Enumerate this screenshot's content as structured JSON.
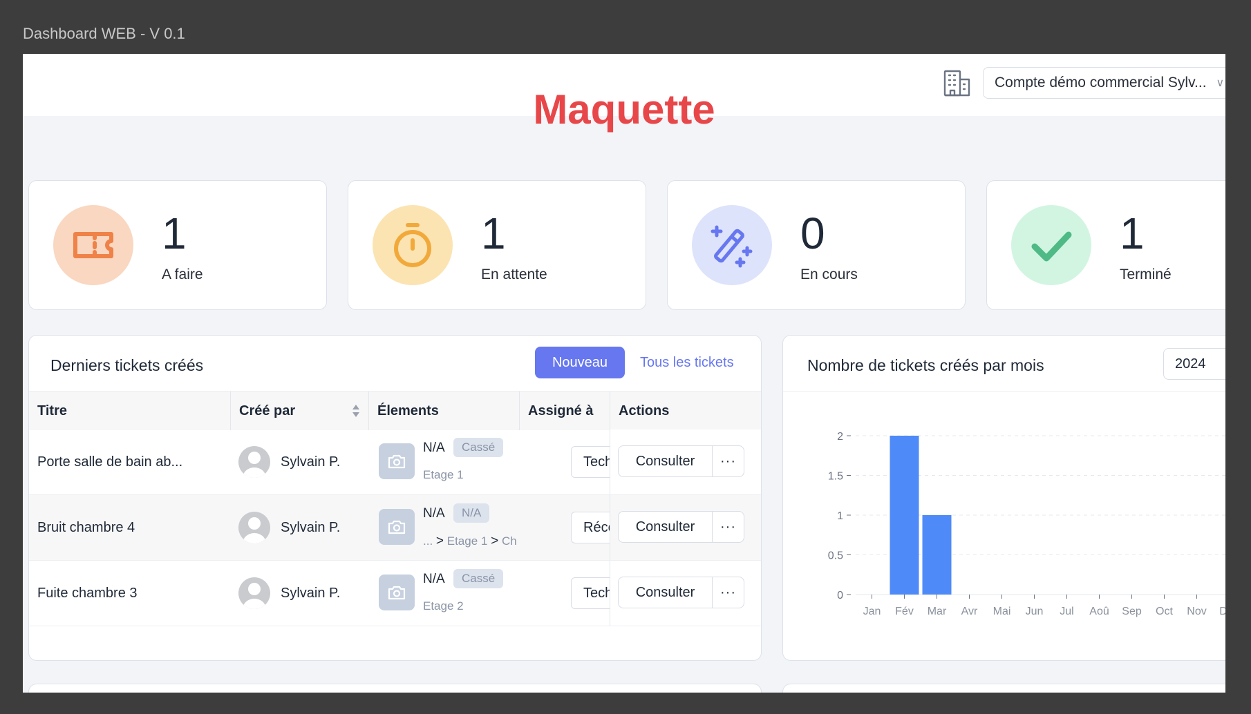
{
  "frame": {
    "title": "Dashboard WEB - V 0.1"
  },
  "header": {
    "account": "Compte démo commercial Sylv...",
    "watermark": "Maquette"
  },
  "stats": [
    {
      "count": "1",
      "label": "A faire",
      "icon": "ticket-icon",
      "bg": "#f9d7c0",
      "color": "#ef8248"
    },
    {
      "count": "1",
      "label": "En attente",
      "icon": "stopwatch-icon",
      "bg": "#fbe4b2",
      "color": "#f2a93b"
    },
    {
      "count": "0",
      "label": "En cours",
      "icon": "magic-wand-icon",
      "bg": "#dde3fb",
      "color": "#6677f0"
    },
    {
      "count": "1",
      "label": "Terminé",
      "icon": "checkmark-icon",
      "bg": "#d2f5e2",
      "color": "#4fba85"
    }
  ],
  "tickets": {
    "title": "Derniers tickets créés",
    "new_label": "Nouveau",
    "all_label": "Tous les tickets",
    "columns": [
      "Titre",
      "Créé par",
      "Élements",
      "Assigné à",
      "Actions"
    ],
    "rows": [
      {
        "title": "Porte salle de bain ab...",
        "creator": "Sylvain P.",
        "element": "N/A",
        "badge": "Cassé",
        "loc_parts": [
          "Etage 1"
        ],
        "assigned": "Tech",
        "consult": "Consulter",
        "more": "···"
      },
      {
        "title": "Bruit chambre 4",
        "creator": "Sylvain P.",
        "element": "N/A",
        "badge": "N/A",
        "loc_parts": [
          "...",
          ">",
          "Etage 1",
          ">",
          "Ch"
        ],
        "assigned": "Réce",
        "consult": "Consulter",
        "more": "···"
      },
      {
        "title": "Fuite chambre 3",
        "creator": "Sylvain P.",
        "element": "N/A",
        "badge": "Cassé",
        "loc_parts": [
          "Etage 2"
        ],
        "assigned": "Tech",
        "consult": "Consulter",
        "more": "···"
      }
    ]
  },
  "chart_panel": {
    "title": "Nombre de tickets créés par mois",
    "year": "2024"
  },
  "chart_data": {
    "type": "bar",
    "categories": [
      "Jan",
      "Fév",
      "Mar",
      "Avr",
      "Mai",
      "Jun",
      "Jul",
      "Aoû",
      "Sep",
      "Oct",
      "Nov",
      "Déc"
    ],
    "values": [
      0,
      2,
      1,
      0,
      0,
      0,
      0,
      0,
      0,
      0,
      0,
      0
    ],
    "yticks": [
      "0",
      "0.5",
      "1",
      "1.5",
      "2"
    ],
    "ylim": [
      0,
      2
    ],
    "grid": true,
    "bar_color": "#4e8af8"
  }
}
